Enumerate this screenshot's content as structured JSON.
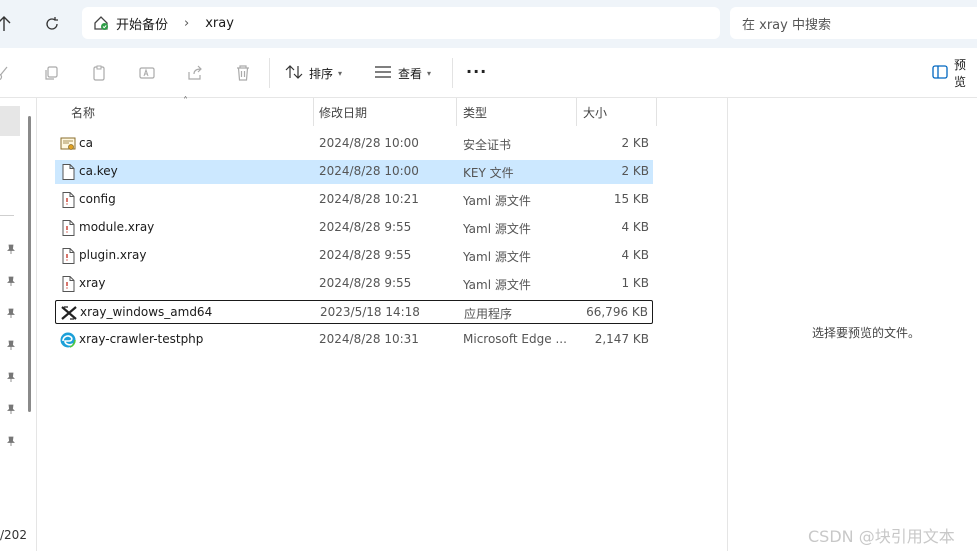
{
  "address": {
    "segments": [
      "开始备份",
      "xray"
    ]
  },
  "search": {
    "placeholder": "在 xray 中搜索"
  },
  "toolbar": {
    "sort_label": "排序",
    "view_label": "查看",
    "more_label": "···",
    "preview_label": "预览"
  },
  "columns": {
    "name": "名称",
    "date": "修改日期",
    "type": "类型",
    "size": "大小"
  },
  "files": [
    {
      "name": "ca",
      "date": "2024/8/28 10:00",
      "type": "安全证书",
      "size": "2 KB",
      "icon": "certificate-icon"
    },
    {
      "name": "ca.key",
      "date": "2024/8/28 10:00",
      "type": "KEY 文件",
      "size": "2 KB",
      "icon": "file-icon"
    },
    {
      "name": "config",
      "date": "2024/8/28 10:21",
      "type": "Yaml 源文件",
      "size": "15 KB",
      "icon": "yaml-file-icon"
    },
    {
      "name": "module.xray",
      "date": "2024/8/28 9:55",
      "type": "Yaml 源文件",
      "size": "4 KB",
      "icon": "yaml-file-icon"
    },
    {
      "name": "plugin.xray",
      "date": "2024/8/28 9:55",
      "type": "Yaml 源文件",
      "size": "4 KB",
      "icon": "yaml-file-icon"
    },
    {
      "name": "xray",
      "date": "2024/8/28 9:55",
      "type": "Yaml 源文件",
      "size": "1 KB",
      "icon": "yaml-file-icon"
    },
    {
      "name": "xray_windows_amd64",
      "date": "2023/5/18 14:18",
      "type": "应用程序",
      "size": "66,796 KB",
      "icon": "application-icon"
    },
    {
      "name": "xray-crawler-testphp",
      "date": "2024/8/28 10:31",
      "type": "Microsoft Edge ...",
      "size": "2,147 KB",
      "icon": "edge-icon"
    }
  ],
  "sidebar": {
    "date_fragment": "/202"
  },
  "preview": {
    "message": "选择要预览的文件。"
  },
  "watermark": "CSDN @块引用文本",
  "colors": {
    "selection": "#cce8ff",
    "titlebar": "#eff4f9"
  }
}
